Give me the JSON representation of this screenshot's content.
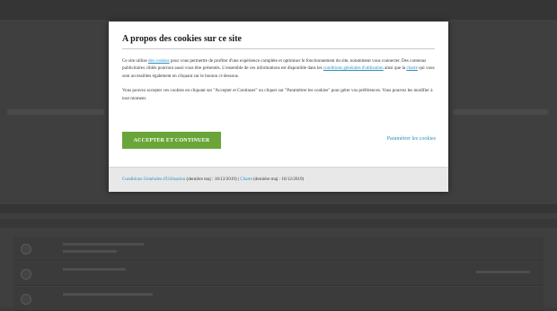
{
  "modal": {
    "title": "A propos des cookies sur ce site",
    "p1_a": "Ce site utilise ",
    "p1_link1": "des cookies",
    "p1_b": " pour vous permettre de profiter d'une expérience complète et optimiser le fonctionnement du site, notamment vous connecter.  Des contenus publicitaires ciblés pourront aussi vous être présentés. L'ensemble de ces informations est disponible dans les ",
    "p1_link2": "conditions générales d'utilisation",
    "p1_c": " ainsi que la ",
    "p1_link3": "charte",
    "p1_d": " qui vous sont accessibles également en cliquant sur le bouton ci-dessous.",
    "p2": "Vous pouvez accepter ces cookies en cliquant sur \"Accepter et Continuer\" ou cliquer sur \"Paramétrer les cookies\" pour gérer vos préférences. Vous pourrez les modifier à tout moment.",
    "accept_label": "ACCEPTER ET CONTINUER",
    "settings_label": "Paramétrer les cookies"
  },
  "footer": {
    "cgu_link": "Conditions Générales d'Utilisation",
    "cgu_date": " (dernière maj : 16/12/2019) | ",
    "charte_link": "Charte",
    "charte_date": " (dernière maj : 16/12/2019)"
  },
  "colors": {
    "accent_button": "#6aa539",
    "link": "#2a8fc0",
    "overlay": "#3f3f3f"
  }
}
